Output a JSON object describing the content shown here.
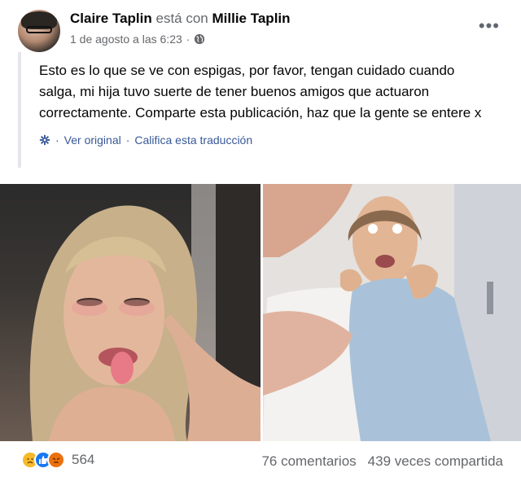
{
  "post": {
    "author": "Claire Taplin",
    "with_text": "está con",
    "tagged": "Millie Taplin",
    "timestamp": "1 de agosto a las 6:23",
    "dot": "·",
    "more_label": "•••",
    "text": "Esto es lo que se ve con espigas, por favor, tengan cuidado cuando salga, mi hija tuvo suerte de tener buenos amigos que actuaron correctamente. Comparte esta publicación, haz que la gente se entere x",
    "translation": {
      "see_original": "Ver original",
      "separator": "·",
      "rate": "Califica esta traducción"
    }
  },
  "icons": {
    "privacy": "globe-icon",
    "translation": "gear-icon",
    "more": "more-options-icon"
  },
  "reactions": {
    "types": [
      "sad",
      "like",
      "angry"
    ],
    "count": "564"
  },
  "stats": {
    "comments": "76 comentarios",
    "shares": "439 veces compartida"
  },
  "colors": {
    "link": "#385898",
    "muted": "#65676b",
    "like": "#1877f2",
    "sad": "#f7b928",
    "angry": "#e9710f"
  }
}
